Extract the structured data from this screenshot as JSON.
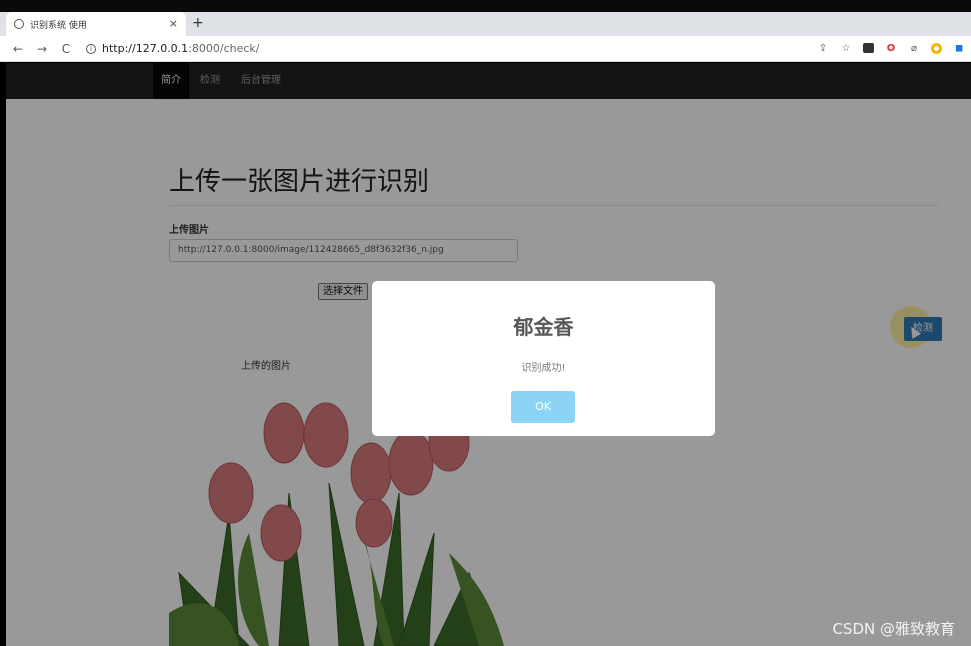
{
  "browser": {
    "tab_title": "识别系统 使用",
    "tab_close": "×",
    "new_tab": "+",
    "back": "←",
    "forward": "→",
    "reload": "C",
    "url_host": "http://127.0.0.1",
    "url_path": ":8000/check/"
  },
  "navbar": {
    "items": [
      "简介",
      "检测",
      "后台管理"
    ]
  },
  "main": {
    "heading": "上传一张图片进行识别",
    "upload_label": "上传图片",
    "image_url_value": "http://127.0.0.1:8000/image/112428665_d8f3632f36_n.jpg",
    "choose_file": "选择文件",
    "detect_button": "检测",
    "preview_label": "上传的图片"
  },
  "modal": {
    "title": "郁金香",
    "message": "识别成功!",
    "ok_label": "OK"
  },
  "watermark": "CSDN @雅致教育",
  "colors": {
    "navbar": "#222222",
    "detect_button": "#337ab7",
    "ok_button": "#8cd4f5"
  }
}
